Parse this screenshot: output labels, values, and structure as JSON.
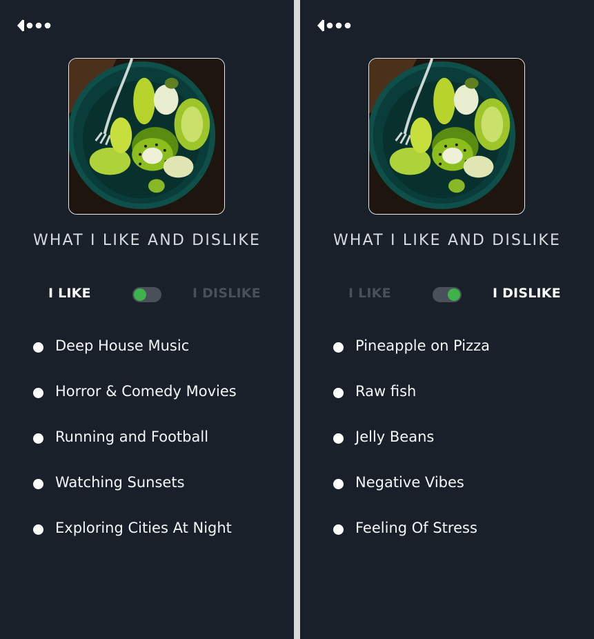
{
  "screens": [
    {
      "title": "WHAT I LIKE AND DISLIKE",
      "toggle": {
        "left_label": "I LIKE",
        "right_label": "I DISLIKE",
        "state": "like"
      },
      "items": [
        "Deep House Music",
        "Horror & Comedy Movies",
        "Running and Football",
        "Watching Sunsets",
        "Exploring Cities At Night"
      ]
    },
    {
      "title": "WHAT I LIKE AND DISLIKE",
      "toggle": {
        "left_label": "I LIKE",
        "right_label": "I DISLIKE",
        "state": "dislike"
      },
      "items": [
        "Pineapple on Pizza",
        "Raw fish",
        "Jelly Beans",
        "Negative Vibes",
        "Feeling Of Stress"
      ]
    }
  ],
  "colors": {
    "background": "#19202a",
    "accent": "#3fb24b",
    "divider": "#d9d9d9"
  },
  "icons": {
    "back": "back-arrow-dots-icon",
    "photo": "kiwi-bowl-photo"
  }
}
